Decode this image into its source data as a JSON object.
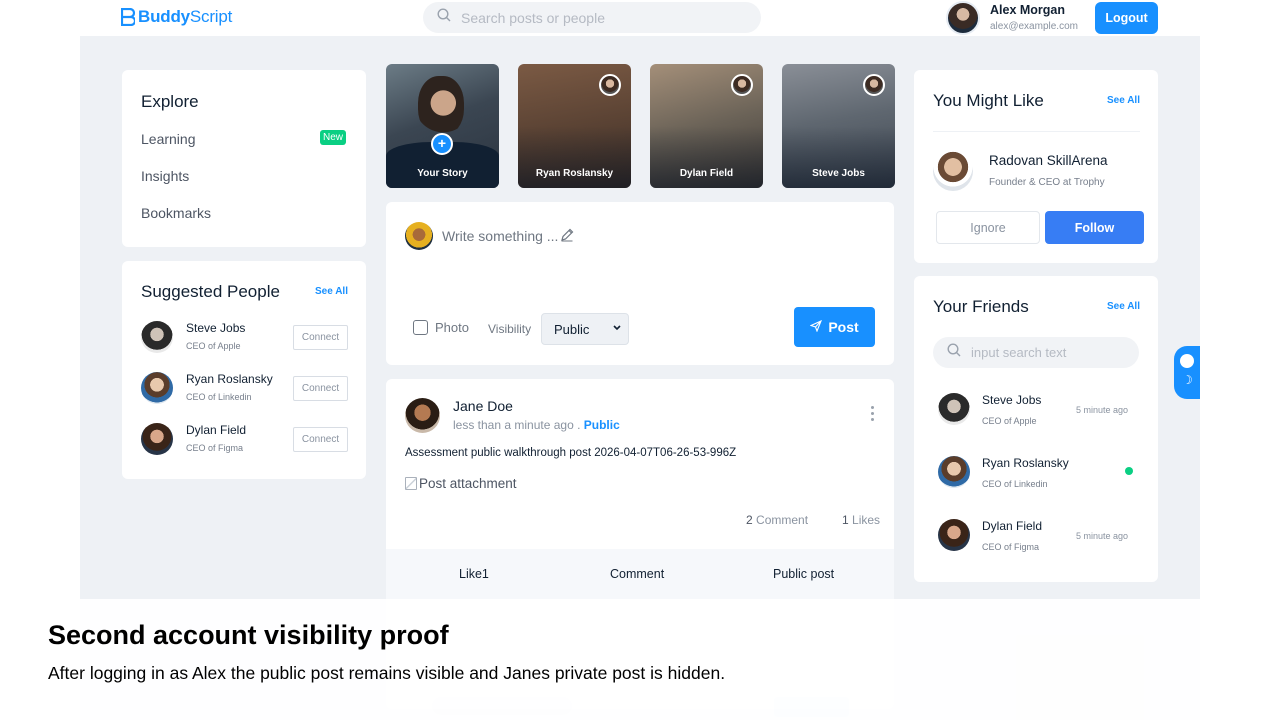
{
  "header": {
    "logo_bold": "Buddy",
    "logo_light": "Script",
    "search_placeholder": "Search posts or people",
    "user_name": "Alex Morgan",
    "user_email": "alex@example.com",
    "logout_label": "Logout"
  },
  "explore": {
    "title": "Explore",
    "items": [
      {
        "label": "Learning",
        "badge": "New"
      },
      {
        "label": "Insights"
      },
      {
        "label": "Bookmarks"
      }
    ]
  },
  "suggested": {
    "title": "Suggested People",
    "see_all": "See All",
    "people": [
      {
        "name": "Steve Jobs",
        "role": "CEO of Apple",
        "action": "Connect"
      },
      {
        "name": "Ryan Roslansky",
        "role": "CEO of Linkedin",
        "action": "Connect"
      },
      {
        "name": "Dylan Field",
        "role": "CEO of Figma",
        "action": "Connect"
      }
    ]
  },
  "stories": [
    {
      "name": "Your Story",
      "add_icon": "plus-icon"
    },
    {
      "name": "Ryan Roslansky"
    },
    {
      "name": "Dylan Field"
    },
    {
      "name": "Steve Jobs"
    }
  ],
  "composer": {
    "placeholder": "Write something ...",
    "photo_label": "Photo",
    "visibility_label": "Visibility",
    "visibility_value": "Public",
    "post_label": "Post"
  },
  "post": {
    "author": "Jane Doe",
    "time": "less than a minute ago .",
    "visibility": "Public",
    "text": "Assessment public walkthrough post 2026-04-07T06-26-53-996Z",
    "attachment_alt": "Post attachment",
    "comments_count": "2",
    "comments_label": "Comment",
    "likes_count": "1",
    "likes_label": "Likes",
    "actions": [
      "Like1",
      "Comment",
      "Public post"
    ]
  },
  "might_like": {
    "title": "You Might Like",
    "see_all": "See All",
    "name": "Radovan SkillArena",
    "role": "Founder & CEO at Trophy",
    "ignore_label": "Ignore",
    "follow_label": "Follow"
  },
  "friends": {
    "title": "Your Friends",
    "see_all": "See All",
    "search_placeholder": "input search text",
    "list": [
      {
        "name": "Steve Jobs",
        "role": "CEO of Apple",
        "status": "5 minute ago"
      },
      {
        "name": "Ryan Roslansky",
        "role": "CEO of Linkedin",
        "status": "online"
      },
      {
        "name": "Dylan Field",
        "role": "CEO of Figma",
        "status": "5 minute ago"
      }
    ]
  },
  "caption": {
    "title": "Second account visibility proof",
    "text": "After logging in as Alex the public post remains visible and Janes private post is hidden."
  },
  "colors": {
    "accent": "#1890ff",
    "page_bg": "#eef1f5",
    "online": "#0acf83",
    "follow": "#377df4"
  }
}
